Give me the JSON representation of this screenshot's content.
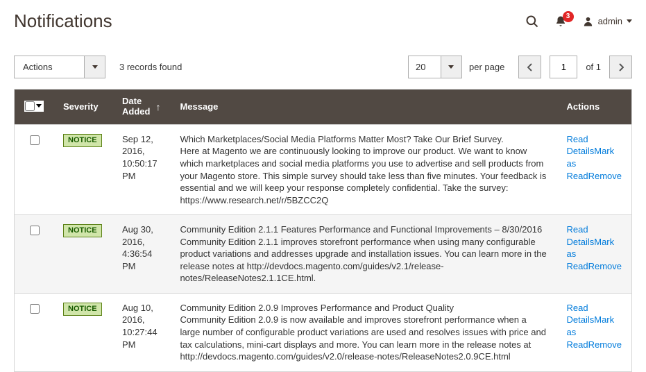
{
  "header": {
    "title": "Notifications",
    "user_label": "admin",
    "notification_count": "3"
  },
  "toolbar": {
    "actions_label": "Actions",
    "records_found": "3 records found",
    "page_size_value": "20",
    "per_page_label": "per page",
    "current_page": "1",
    "of_label": "of 1"
  },
  "columns": {
    "severity": "Severity",
    "date_added_line1": "Date",
    "date_added_line2": "Added",
    "message": "Message",
    "actions": "Actions"
  },
  "action_labels": {
    "read_details": "Read Details",
    "mark_as_read": "Mark as Read",
    "remove": "Remove"
  },
  "rows": [
    {
      "severity": "NOTICE",
      "date": "Sep 12, 2016, 10:50:17 PM",
      "title": "Which Marketplaces/Social Media Platforms Matter Most? Take Our Brief Survey.",
      "body": "Here at Magento we are continuously looking to improve our product. We want to know which marketplaces and social media platforms you use to advertise and sell products from your Magento store. This simple survey should take less than five minutes. Your feedback is essential and we will keep your response completely confidential. Take the survey: https://www.research.net/r/5BZCC2Q"
    },
    {
      "severity": "NOTICE",
      "date": "Aug 30, 2016, 4:36:54 PM",
      "title": "Community Edition 2.1.1 Features Performance and Functional Improvements – 8/30/2016",
      "body": "Community Edition 2.1.1 improves storefront performance when using many configurable product variations and addresses upgrade and installation issues. You can learn more in the release notes at http://devdocs.magento.com/guides/v2.1/release-notes/ReleaseNotes2.1.1CE.html."
    },
    {
      "severity": "NOTICE",
      "date": "Aug 10, 2016, 10:27:44 PM",
      "title": "Community Edition 2.0.9 Improves Performance and Product Quality",
      "body": "Community Edition 2.0.9 is now available and improves storefront performance when a large number of configurable product variations are used and resolves issues with price and tax calculations, mini-cart displays and more. You can learn more in the release notes at http://devdocs.magento.com/guides/v2.0/release-notes/ReleaseNotes2.0.9CE.html"
    }
  ]
}
